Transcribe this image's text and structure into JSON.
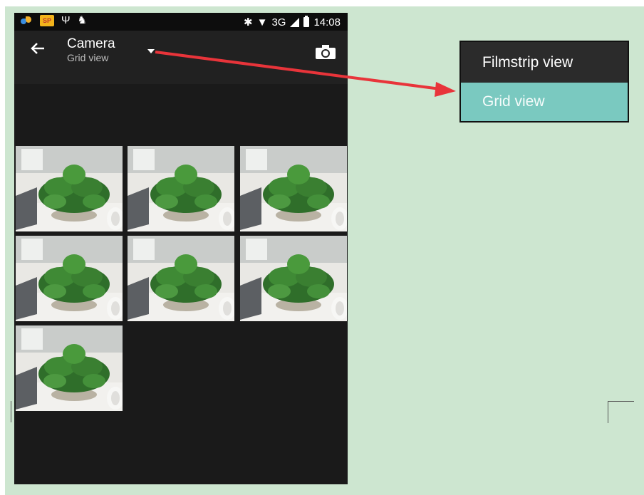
{
  "status_bar": {
    "notif_badge": "SP",
    "bluetooth": "✱",
    "network": "3G",
    "time": "14:08"
  },
  "app_bar": {
    "back_icon": "arrow-left-icon",
    "title": "Camera",
    "subtitle": "Grid view",
    "dropdown_icon": "dropdown-triangle-icon",
    "camera_icon": "camera-icon"
  },
  "grid": {
    "thumbnails": [
      "photo-1",
      "photo-2",
      "photo-3",
      "photo-4",
      "photo-5",
      "photo-6",
      "photo-7"
    ]
  },
  "popup": {
    "items": [
      {
        "label": "Filmstrip view",
        "selected": false
      },
      {
        "label": "Grid view",
        "selected": true
      }
    ]
  },
  "colors": {
    "page_background": "#cde6d0",
    "phone_background": "#1a1a1a",
    "app_bar": "#212121",
    "popup_background": "#2b2b2b",
    "popup_selected": "#7ac9c0",
    "annotation_arrow": "#e8343a"
  }
}
